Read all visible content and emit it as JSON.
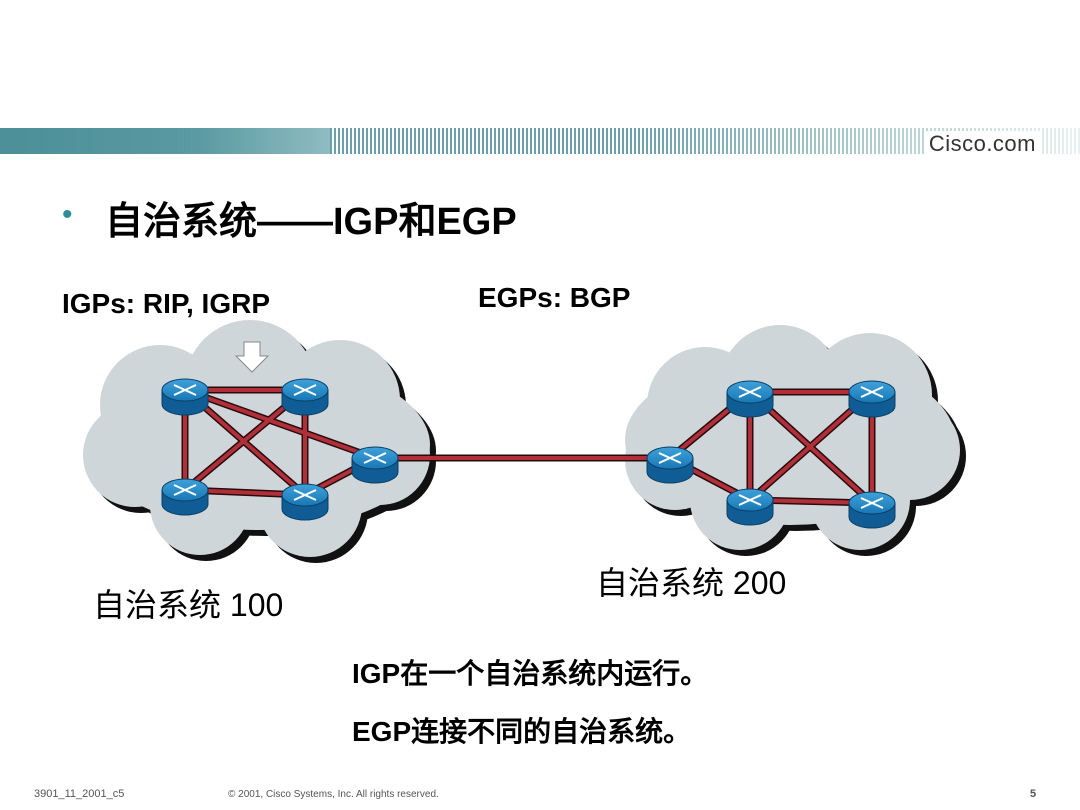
{
  "header": {
    "brand": "Cisco.com"
  },
  "slide": {
    "bullet_symbol": "•",
    "title": "自治系统——IGP和EGP",
    "igp_label": "IGPs: RIP, IGRP",
    "egp_label": "EGPs: BGP",
    "as1_label": "自治系统 100",
    "as2_label": "自治系统 200",
    "note1": "IGP在一个自治系统内运行。",
    "note2": "EGP连接不同的自治系统。"
  },
  "footer": {
    "code": "3901_11_2001_c5",
    "copyright": "© 2001, Cisco Systems, Inc. All rights reserved.",
    "page_number": "5"
  },
  "colors": {
    "accent_teal": "#2f8d95",
    "link_red": "#b0303a",
    "cloud_fill": "#cfd6da",
    "router_blue": "#1a79b8"
  },
  "icons": [
    "router-icon",
    "cloud-shape",
    "arrow-down-icon"
  ]
}
